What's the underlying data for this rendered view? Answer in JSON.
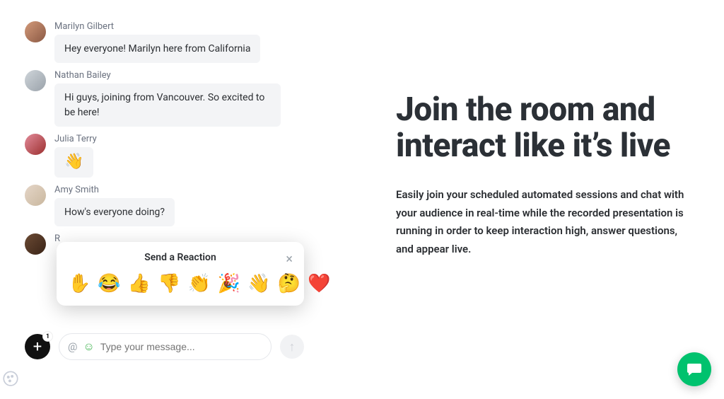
{
  "chat": {
    "messages": [
      {
        "name": "Marilyn Gilbert",
        "text": "Hey everyone! Marilyn here from California"
      },
      {
        "name": "Nathan Bailey",
        "text": "Hi guys, joining from Vancouver. So excited to be here!"
      },
      {
        "name": "Julia Terry",
        "text": "👋"
      },
      {
        "name": "Amy Smith",
        "text": "How's everyone doing?"
      },
      {
        "name": "R"
      }
    ]
  },
  "reaction": {
    "title": "Send a Reaction",
    "emojis": [
      "✋",
      "😂",
      "👍",
      "👎",
      "👏",
      "🎉",
      "👋",
      "🤔",
      "❤️"
    ],
    "close_label": "×"
  },
  "composer": {
    "plus_label": "+",
    "badge": "1",
    "at": "@",
    "smiley": "☺",
    "placeholder": "Type your message...",
    "send_icon": "↑"
  },
  "marketing": {
    "headline": "Join the room and interact like it’s live",
    "subcopy": "Easily join your scheduled automated sessions and chat with your audience in real-time while the recorded presentation is running in order to keep interaction high, answer questions, and appear live."
  }
}
